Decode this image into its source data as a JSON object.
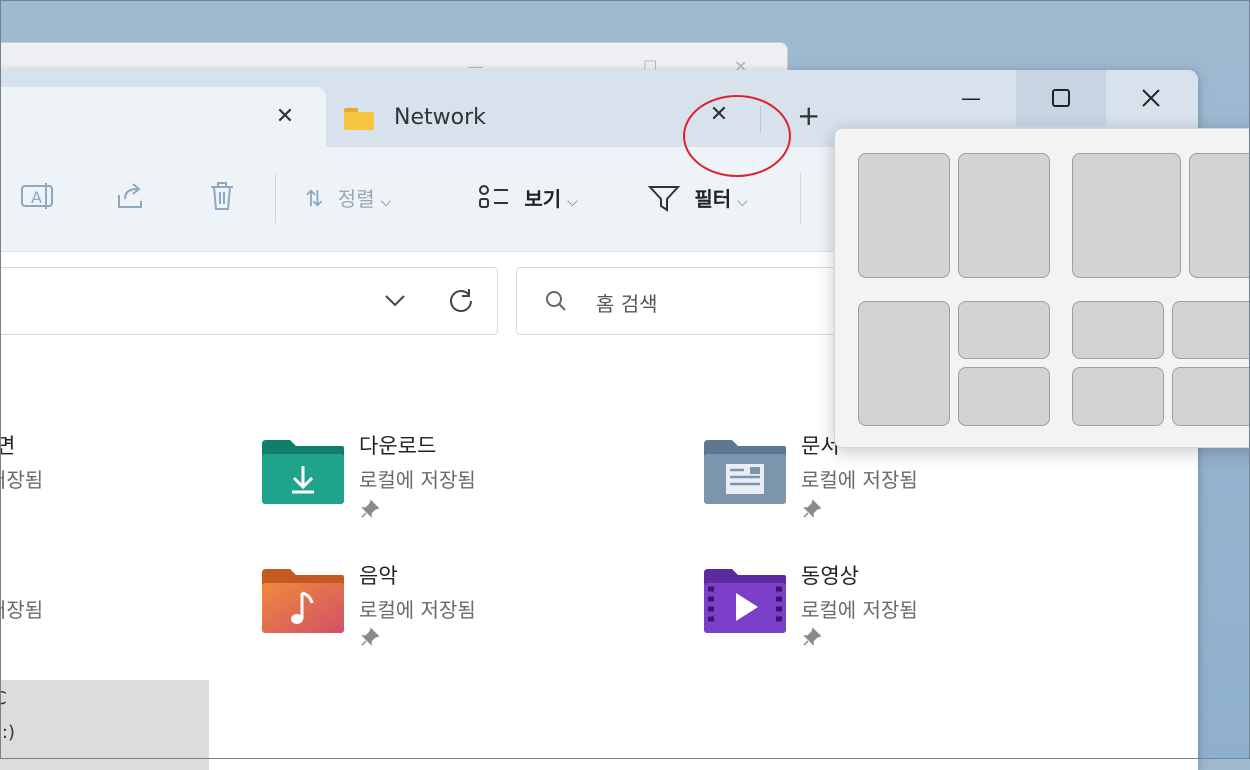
{
  "tabs": [
    {
      "label": ""
    },
    {
      "label": "Network"
    }
  ],
  "window_controls": {
    "minimize": "—",
    "maximize": "☐",
    "close": "✕"
  },
  "toolbar": {
    "sort_label": "정렬",
    "view_label": "보기",
    "filter_label": "필터"
  },
  "search": {
    "placeholder": "홈 검색"
  },
  "items": [
    {
      "name": "면",
      "sub": "저장됨",
      "icon": "desktop-folder-icon"
    },
    {
      "name": "다운로드",
      "sub": "로컬에 저장됨",
      "icon": "downloads-folder-icon"
    },
    {
      "name": "문서",
      "sub": "로컬에 저장됨",
      "icon": "documents-folder-icon"
    },
    {
      "name": "",
      "sub": "저장됨",
      "icon": "pictures-folder-icon"
    },
    {
      "name": "음악",
      "sub": "로컬에 저장됨",
      "icon": "music-folder-icon"
    },
    {
      "name": "동영상",
      "sub": "로컬에 저장됨",
      "icon": "videos-folder-icon"
    }
  ],
  "drive": {
    "name": "C",
    "sub": "c:)"
  },
  "colors": {
    "titlebar": "#d7e2ed",
    "toolbar": "#eef3f8",
    "annotation": "#e0202a",
    "downloads": "#1fa38a",
    "music": "#e56f3c",
    "videos": "#7b3fc9",
    "documents": "#7d94ad"
  }
}
